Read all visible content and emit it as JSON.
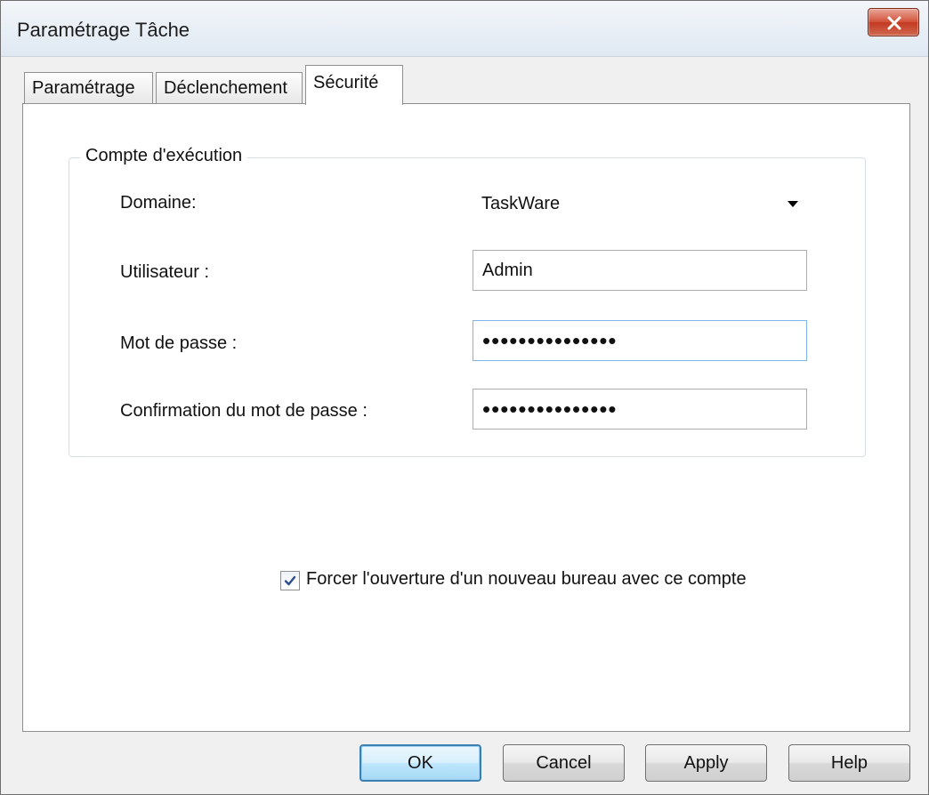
{
  "window": {
    "title": "Paramétrage Tâche"
  },
  "tabs": [
    {
      "label": "Paramétrage",
      "active": false
    },
    {
      "label": "Déclenchement",
      "active": false
    },
    {
      "label": "Sécurité",
      "active": true
    }
  ],
  "group": {
    "legend": "Compte d'exécution",
    "domain_label": "Domaine:",
    "domain_value": "TaskWare",
    "user_label": "Utilisateur :",
    "user_value": "Admin",
    "password_label": "Mot de passe :",
    "password_value": "•••••••••••••••",
    "confirm_label": "Confirmation du mot de passe :",
    "confirm_value": "•••••••••••••••"
  },
  "options": {
    "force_desktop_label": "Forcer l'ouverture d'un nouveau bureau avec ce compte",
    "force_desktop_checked": true
  },
  "buttons": {
    "ok": "OK",
    "cancel": "Cancel",
    "apply": "Apply",
    "help": "Help"
  },
  "icons": {
    "close": "close-icon",
    "check": "check-icon",
    "dropdown": "chevron-down-icon"
  },
  "colors": {
    "close_button": "#c43a22",
    "default_button_border": "#3c7fb1",
    "focus_border": "#7eb4ea"
  }
}
